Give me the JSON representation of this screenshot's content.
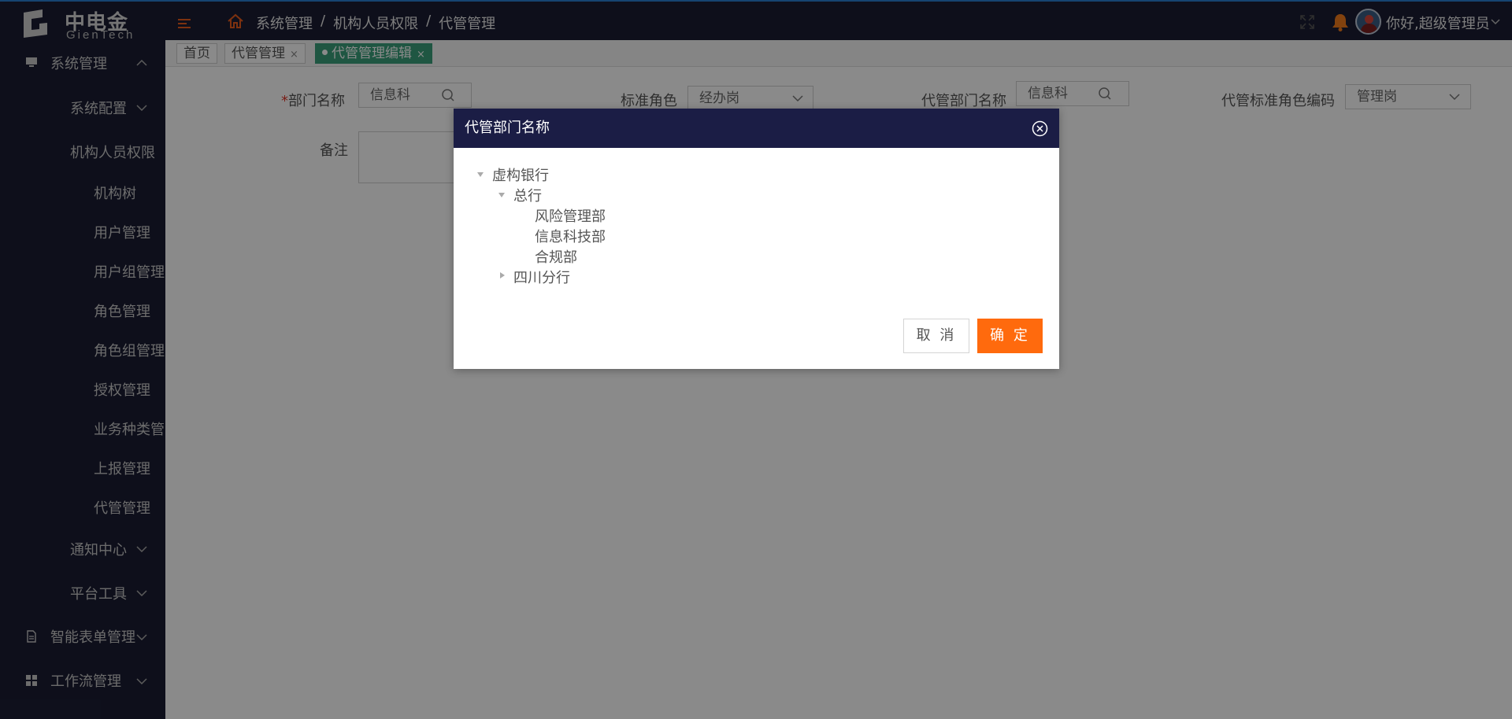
{
  "header": {
    "logo_cn": "中电金信",
    "logo_en": "GienTech",
    "breadcrumb": [
      "系统管理",
      "机构人员权限",
      "代管管理"
    ],
    "breadcrumb_sep": "/",
    "user_greeting": "你好,超级管理员"
  },
  "sidebar": {
    "system_mgmt": "系统管理",
    "system_config": "系统配置",
    "org_perm": "机构人员权限",
    "org_tree": "机构树",
    "user_mgmt": "用户管理",
    "user_group_mgmt": "用户组管理",
    "role_mgmt": "角色管理",
    "role_group_mgmt": "角色组管理",
    "auth_mgmt": "授权管理",
    "biz_type_mgmt": "业务种类管",
    "report_mgmt": "上报管理",
    "delegate_mgmt": "代管管理",
    "notice_center": "通知中心",
    "platform_tools": "平台工具",
    "smart_form_mgmt": "智能表单管理",
    "workflow_mgmt": "工作流管理"
  },
  "tabs": [
    {
      "label": "首页"
    },
    {
      "label": "代管管理",
      "close": "×"
    },
    {
      "label": "代管管理编辑",
      "close": "×",
      "active": true
    }
  ],
  "form": {
    "dept_name_label": "部门名称",
    "dept_name_required": "*",
    "dept_name_value": "信息科",
    "std_role_label": "标准角色",
    "std_role_value": "经办岗",
    "deleg_dept_label": "代管部门名称",
    "deleg_dept_value": "信息科",
    "deleg_role_code_label": "代管标准角色编码",
    "deleg_role_code_value": "管理岗",
    "remark_label": "备注"
  },
  "modal": {
    "title": "代管部门名称",
    "tree": {
      "root": "虚构银行",
      "head_office": "总行",
      "risk_dept": "风险管理部",
      "it_dept": "信息科技部",
      "compliance_dept": "合规部",
      "sichuan_branch": "四川分行"
    },
    "cancel_label": "取 消",
    "confirm_label": "确 定"
  },
  "colors": {
    "header_bg": "#1b1d33",
    "accent_orange": "#ff6a0d",
    "active_tab": "#3aa07a",
    "modal_header": "#1b1d45"
  }
}
